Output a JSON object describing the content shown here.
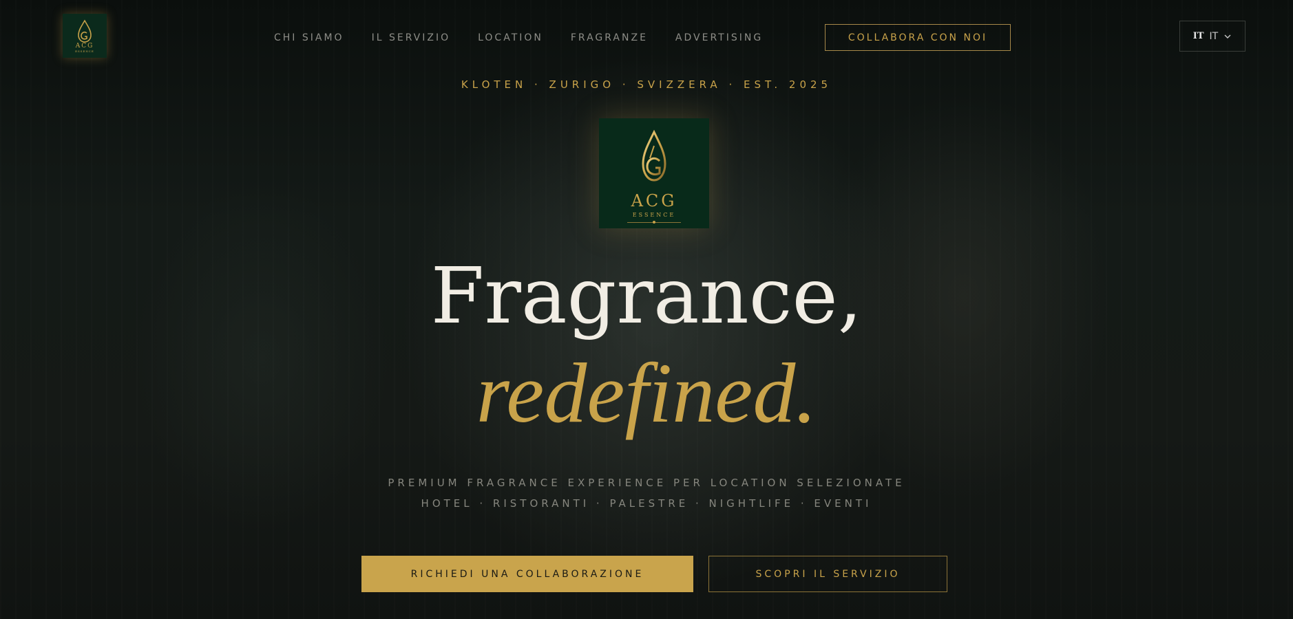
{
  "brand": {
    "monogram": "ACG",
    "name": "ESSENCE"
  },
  "nav": {
    "items": [
      {
        "label": "CHI SIAMO"
      },
      {
        "label": "IL SERVIZIO"
      },
      {
        "label": "LOCATION"
      },
      {
        "label": "FRAGRANZE"
      },
      {
        "label": "ADVERTISING"
      }
    ],
    "cta_label": "COLLABORA CON NOI"
  },
  "language": {
    "flag": "IT",
    "selected": "IT",
    "icon": "chevron-down-icon"
  },
  "hero": {
    "location_line": "KLOTEN · ZURIGO · SVIZZERA · EST. 2025",
    "headline_line1": "Fragrance,",
    "headline_line2": "redefined.",
    "tagline_line1": "PREMIUM FRAGRANCE EXPERIENCE PER LOCATION SELEZIONATE",
    "tagline_line2": "HOTEL · RISTORANTI · PALESTRE · NIGHTLIFE · EVENTI",
    "primary_button": "RICHIEDI UNA COLLABORAZIONE",
    "secondary_button": "SCOPRI IL SERVIZIO"
  },
  "colors": {
    "accent_gold": "#c9a34a",
    "brand_green": "#082a1a",
    "background": "#111613",
    "headline_white": "#f1ede4"
  }
}
